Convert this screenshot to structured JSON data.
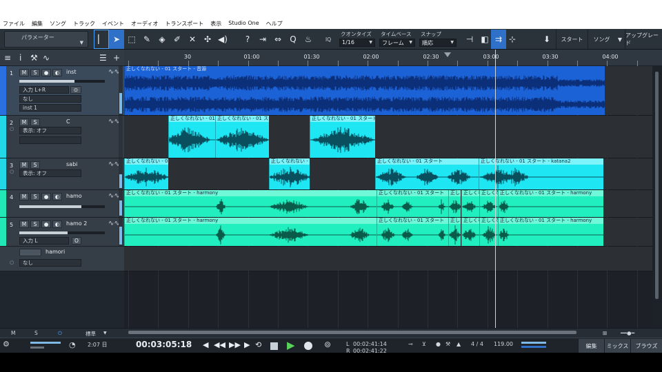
{
  "menu": [
    "ファイル",
    "編集",
    "ソング",
    "トラック",
    "イベント",
    "オーディオ",
    "トランスポート",
    "表示",
    "Studio One",
    "ヘルプ"
  ],
  "toolbar": {
    "parameter_label": "パラメーター",
    "quantize_label": "クオンタイズ",
    "quantize_value": "1/16",
    "timebase_label": "タイムベース",
    "timebase_value": "フレーム",
    "snap_label": "スナップ",
    "snap_value": "順応",
    "iq_label": "IQ",
    "start_label": "スタート",
    "song_label": "ソング",
    "upgrade_label": "アップグレード"
  },
  "ruler": {
    "labels": [
      "30",
      "01:00",
      "01:30",
      "02:00",
      "02:30",
      "03:00",
      "03:30",
      "04:00"
    ]
  },
  "tracks": [
    {
      "num": "1",
      "name": "inst",
      "color": "#2a70e0",
      "input": "入力 L+R",
      "slot2": "なし",
      "slot3": "inst 1"
    },
    {
      "num": "2",
      "name": "C",
      "color": "#23d8e6",
      "view": "表示: オフ"
    },
    {
      "num": "3",
      "name": "sabi",
      "color": "#23d8e6",
      "view": "表示: オフ"
    },
    {
      "num": "4",
      "name": "hamo",
      "color": "#22e8b8"
    },
    {
      "num": "5",
      "name": "hamo 2",
      "color": "#22e8b8",
      "input": "入力 L",
      "o_label": "O"
    },
    {
      "num": "",
      "name": "hamori",
      "color": "#353e47",
      "slot2": "なし"
    }
  ],
  "track_buttons": {
    "m": "M",
    "s": "S"
  },
  "clips": {
    "inst_title": "正しくなれない - 01 スタート - 音源",
    "clip_title": "正しくなれない - 01 スタート",
    "clip_short": "正しくなれない - 01",
    "harmony_title": "正しくなれない - 01 スタート - harmony",
    "katana_title": "正しくなれない - 01 スタート - katana2"
  },
  "bottom_bar": {
    "m": "M",
    "s": "S",
    "standard": "標準"
  },
  "transport": {
    "time_left": "2:07 日",
    "position": "00:03:05:18",
    "loop_l": "00:02:41:14",
    "loop_r": "00:02:41:22",
    "l_label": "L",
    "r_label": "R",
    "signature": "4 / 4",
    "tempo": "119.00",
    "edit_label": "編集",
    "mix_label": "ミックス",
    "browse_label": "ブラウズ"
  },
  "colors": {
    "inst": "#1b62d6",
    "cyan": "#1ee6f2",
    "teal": "#22efc0",
    "accent": "#2f70c8"
  }
}
